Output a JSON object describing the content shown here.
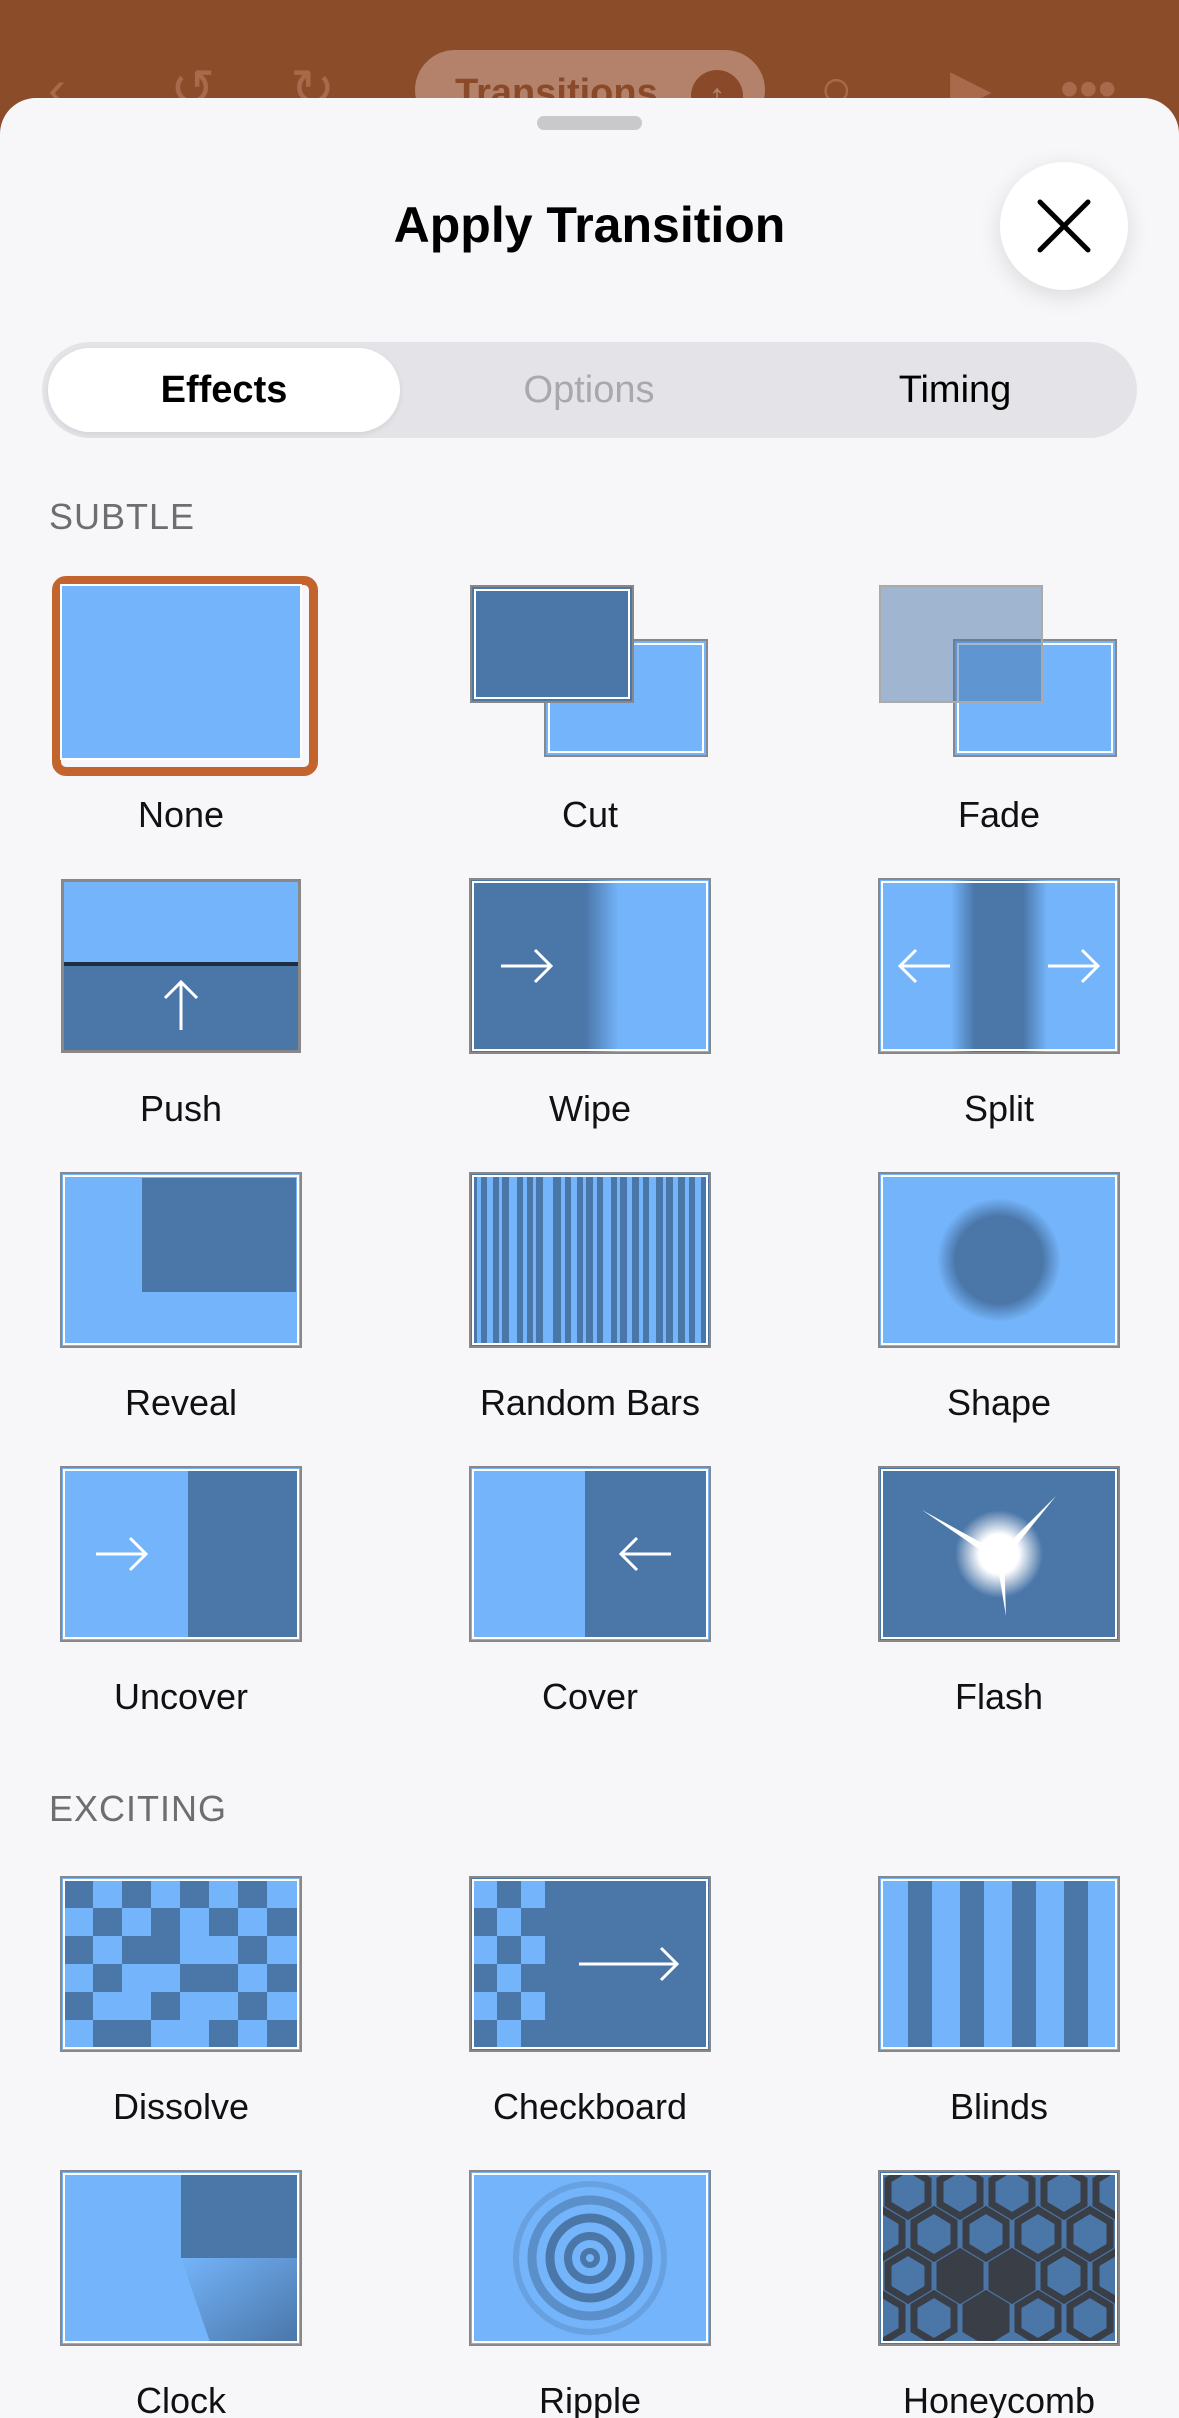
{
  "topbar": {
    "pill_label": "Transitions",
    "icons": [
      "back-arrow-icon",
      "undo-icon",
      "redo-icon",
      "search-icon",
      "play-icon",
      "more-icon"
    ]
  },
  "sheet": {
    "title": "Apply Transition",
    "close_icon": "close-icon"
  },
  "tabs": [
    {
      "label": "Effects",
      "state": "selected"
    },
    {
      "label": "Options",
      "state": "disabled"
    },
    {
      "label": "Timing",
      "state": "normal"
    }
  ],
  "sections": [
    {
      "header": "SUBTLE",
      "items": [
        "None",
        "Cut",
        "Fade",
        "Push",
        "Wipe",
        "Split",
        "Reveal",
        "Random Bars",
        "Shape",
        "Uncover",
        "Cover",
        "Flash"
      ]
    },
    {
      "header": "EXCITING",
      "items": [
        "Dissolve",
        "Checkboard",
        "Blinds",
        "Clock",
        "Ripple",
        "Honeycomb"
      ]
    }
  ],
  "selected_effect": "None",
  "colors": {
    "accent": "#c3642f",
    "thumb_light": "#74b4fa",
    "thumb_dark": "#4a76a8",
    "sheet_bg": "#f7f7f9"
  }
}
